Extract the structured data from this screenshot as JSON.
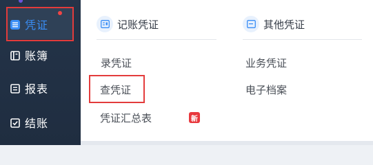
{
  "sidebar": {
    "items": [
      {
        "label": "凭证",
        "icon": "list-icon",
        "active": true,
        "has_dot": true
      },
      {
        "label": "账簿",
        "icon": "book-icon"
      },
      {
        "label": "报表",
        "icon": "report-icon"
      },
      {
        "label": "结账",
        "icon": "checkout-icon"
      }
    ]
  },
  "menu": {
    "groups": [
      {
        "title": "记账凭证",
        "icon": "voucher-icon",
        "links": [
          {
            "label": "录凭证"
          },
          {
            "label": "查凭证",
            "highlighted": true
          },
          {
            "label": "凭证汇总表",
            "badge": "新"
          }
        ]
      },
      {
        "title": "其他凭证",
        "icon": "window-icon",
        "links": [
          {
            "label": "业务凭证"
          },
          {
            "label": "电子档案"
          }
        ]
      }
    ]
  },
  "colors": {
    "sidebar_bg": "#1f2d40",
    "accent": "#3a8ef6",
    "highlight_border": "#e33b3b",
    "badge_bg": "#e8383d"
  }
}
